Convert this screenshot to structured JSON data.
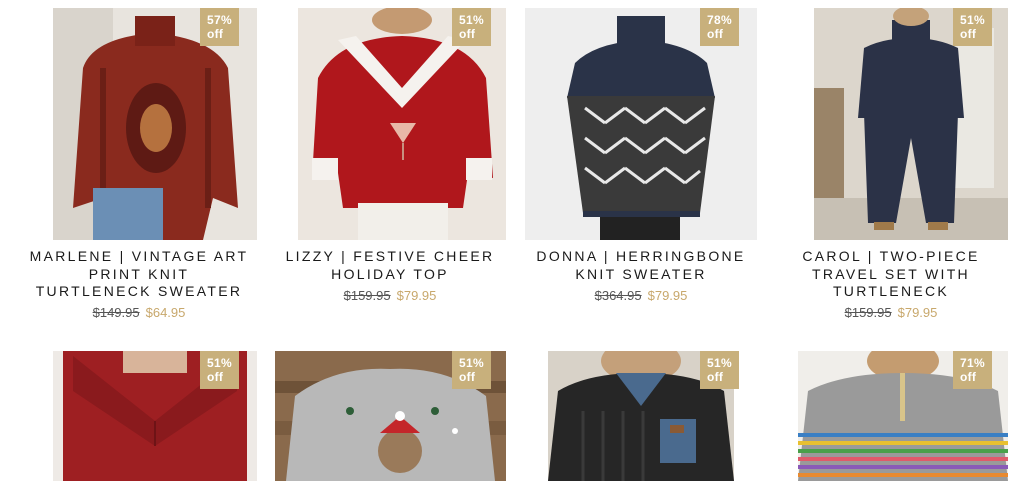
{
  "products": [
    {
      "title": "MARLENE | VINTAGE ART PRINT KNIT TURTLENECK SWEATER",
      "badge": "57% off",
      "old_price": "$149.95",
      "new_price": "$64.95",
      "image_icon": "red-paisley-turtleneck-image"
    },
    {
      "title": "LIZZY | FESTIVE CHEER HOLIDAY TOP",
      "badge": "51% off",
      "old_price": "$159.95",
      "new_price": "$79.95",
      "image_icon": "red-velvet-holiday-top-image"
    },
    {
      "title": "DONNA | HERRINGBONE KNIT SWEATER",
      "badge": "78% off",
      "old_price": "$364.95",
      "new_price": "$79.95",
      "image_icon": "navy-herringbone-sweater-image"
    },
    {
      "title": "CAROL | TWO-PIECE TRAVEL SET WITH TURTLENECK",
      "badge": "51% off",
      "old_price": "$159.95",
      "new_price": "$79.95",
      "image_icon": "navy-two-piece-set-image"
    },
    {
      "badge": "51% off",
      "image_icon": "red-collar-sweater-image"
    },
    {
      "badge": "51% off",
      "image_icon": "grey-cat-christmas-sweater-image"
    },
    {
      "badge": "51% off",
      "image_icon": "black-cable-knit-denim-image"
    },
    {
      "badge": "71% off",
      "image_icon": "grey-rainbow-stripe-zip-image"
    }
  ]
}
